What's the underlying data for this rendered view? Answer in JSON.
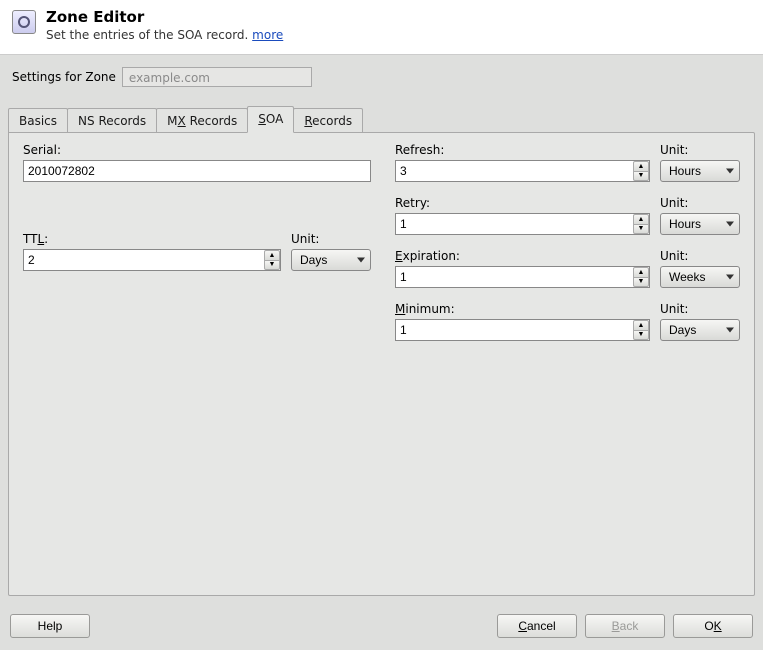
{
  "header": {
    "title": "Zone Editor",
    "subtitle_prefix": "Set the entries of the SOA record. ",
    "more_link": "more"
  },
  "settings": {
    "label": "Settings for Zone",
    "zone_value": "example.com"
  },
  "tabs": {
    "basics": "Basics",
    "ns": "NS Records",
    "mx_pre": "M",
    "mx_mn": "X",
    "mx_post": " Records",
    "soa_mn": "S",
    "soa_post": "OA",
    "records_mn": "R",
    "records_post": "ecords"
  },
  "left": {
    "serial_label": "Serial:",
    "serial_value": "2010072802",
    "ttl_pre": "TT",
    "ttl_mn": "L",
    "ttl_post": ":",
    "ttl_value": "2",
    "ttl_unit_label": "Unit:",
    "ttl_unit_value": "Days"
  },
  "right": {
    "refresh_label": "Refresh:",
    "refresh_value": "3",
    "refresh_unit_label": "Unit:",
    "refresh_unit_value": "Hours",
    "retry_label": "Retry:",
    "retry_value": "1",
    "retry_unit_label": "Unit:",
    "retry_unit_value": "Hours",
    "exp_mn": "E",
    "exp_post": "xpiration:",
    "exp_value": "1",
    "exp_unit_label": "Unit:",
    "exp_unit_value": "Weeks",
    "min_mn": "M",
    "min_post": "inimum:",
    "min_value": "1",
    "min_unit_label": "Unit:",
    "min_unit_value": "Days"
  },
  "buttons": {
    "help": "Help",
    "cancel_mn": "C",
    "cancel_post": "ancel",
    "back_mn": "B",
    "back_post": "ack",
    "ok_pre": "O",
    "ok_mn": "K"
  }
}
